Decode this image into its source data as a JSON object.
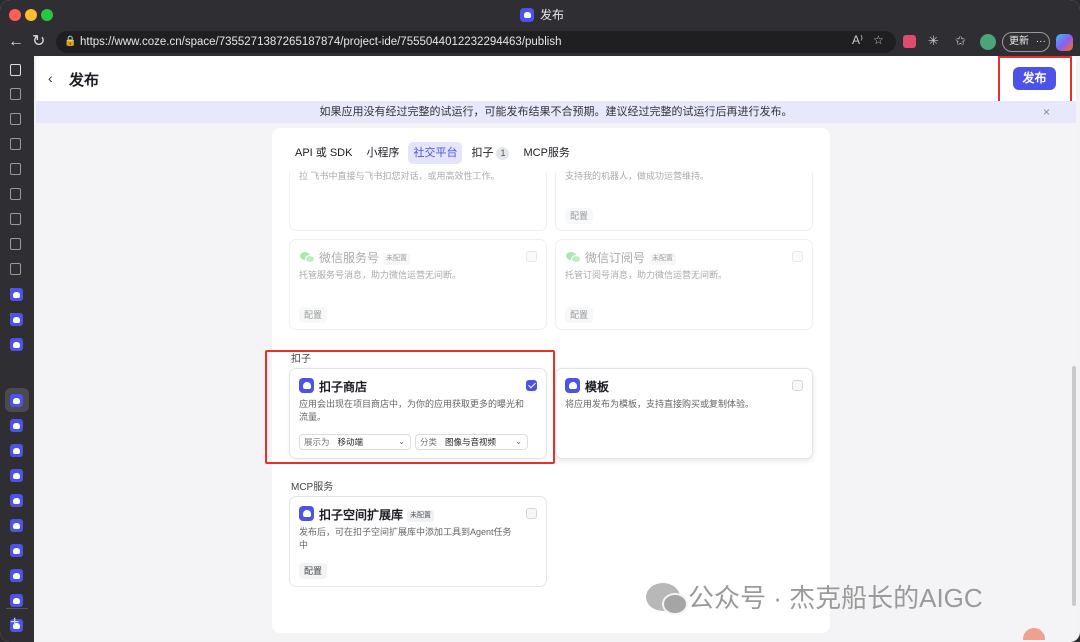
{
  "browser": {
    "tab_title": "发布",
    "url": "https://www.coze.cn/space/7355271387265187874/project-ide/7555044012232294463/publish",
    "update_label": "更新",
    "more_label": "···",
    "reader_label": "A⁾"
  },
  "header": {
    "title": "发布",
    "publish_label": "发布"
  },
  "banner": {
    "text": "如果应用没有经过完整的试运行，可能发布结果不合预期。建议经过完整的试运行后再进行发布。",
    "close": "×"
  },
  "tabs": [
    {
      "label": "API 或 SDK"
    },
    {
      "label": "小程序"
    },
    {
      "label": "社交平台",
      "active": true
    },
    {
      "label": "扣子",
      "badge": "1"
    },
    {
      "label": "MCP服务"
    }
  ],
  "social": {
    "cut_left": "拉 飞书中直接与飞书扣您对话，或用高效性工作。",
    "cut_right": "支持我的机器人，做成功运营维持。",
    "config_label": "配置",
    "cards": [
      {
        "title": "微信服务号",
        "status": "未配置",
        "desc": "托管服务号消息，助力微信运营无间断。",
        "config": "配置"
      },
      {
        "title": "微信订阅号",
        "status": "未配置",
        "desc": "托管订阅号消息，助力微信运营无间断。",
        "config": "配置"
      }
    ]
  },
  "kouzi": {
    "section": "扣子",
    "store": {
      "title": "扣子商店",
      "desc": "应用会出现在项目商店中，为你的应用获取更多的曝光和流量。",
      "display_label": "展示为",
      "display_value": "移动端",
      "category_label": "分类",
      "category_value": "图像与音视频",
      "checked": true
    },
    "template": {
      "title": "模板",
      "desc": "将应用发布为模板，支持直接购买或复制体验。"
    }
  },
  "mcp": {
    "section": "MCP服务",
    "card": {
      "title": "扣子空间扩展库",
      "status": "未配置",
      "desc": "发布后，可在扣子空间扩展库中添加工具到Agent任务中",
      "config": "配置"
    }
  },
  "watermark": {
    "text": "公众号 · 杰克船长的AIGC"
  },
  "colors": {
    "accent": "#4d53e8",
    "highlight": "#e8302a",
    "banner_bg": "#e7e8fb"
  }
}
